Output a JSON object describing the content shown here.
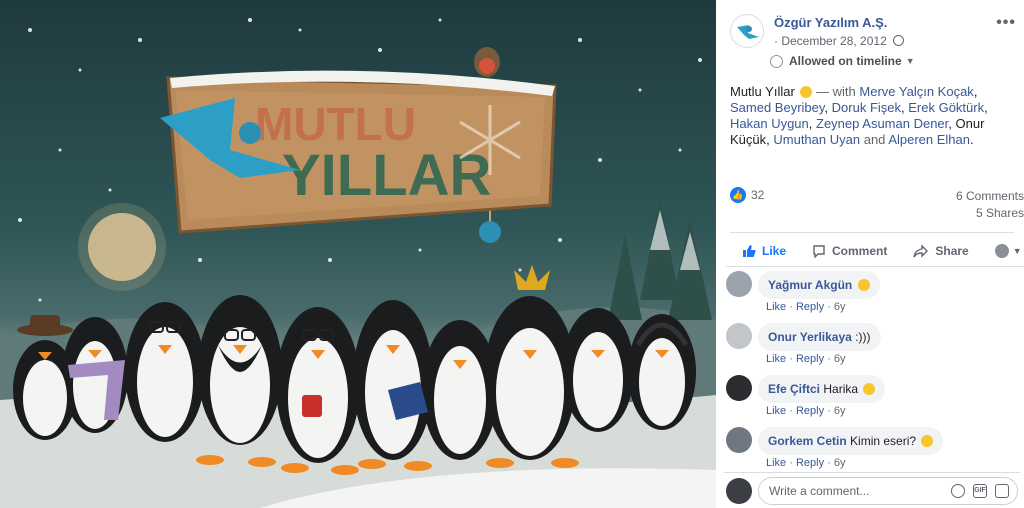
{
  "sign": {
    "line1": "MUTLU",
    "line2": "YILLAR"
  },
  "page": {
    "name": "Özgür Yazılım A.Ş.",
    "date": "December 28, 2012"
  },
  "audience": {
    "label": "Allowed on timeline"
  },
  "post": {
    "text_start": "Mutlu Yıllar",
    "with_label": "— with",
    "tagged": [
      "Merve Yalçın Koçak",
      "Samed Beyribey",
      "Doruk Fişek",
      "Erek Göktürk",
      "Hakan Uygun",
      "Zeynep Asuman Dener",
      "Onur Küçük",
      "Umuthan Uyan",
      "Alperen Elhan"
    ],
    "and_label": "and",
    "end": "."
  },
  "stats": {
    "likes": "32",
    "comments": "6 Comments",
    "shares": "5 Shares"
  },
  "actions": {
    "like": "Like",
    "comment": "Comment",
    "share": "Share"
  },
  "comments": [
    {
      "name": "Yağmur Akgün",
      "text": "",
      "like": "Like",
      "reply": "Reply",
      "time": "6y"
    },
    {
      "name": "Onur Yerlikaya",
      "text": ":)))",
      "like": "Like",
      "reply": "Reply",
      "time": "6y"
    },
    {
      "name": "Efe Çiftci",
      "text": "Harika",
      "like": "Like",
      "reply": "Reply",
      "time": "6y"
    },
    {
      "name": "Gorkem Cetin",
      "text": "Kimin eseri?",
      "like": "Like",
      "reply": "Reply",
      "time": "6y"
    }
  ],
  "composer": {
    "placeholder": "Write a comment...",
    "gif": "GIF"
  },
  "colors": {
    "link": "#385898",
    "like_blue": "#1877f2",
    "sign_wood": "#b98a5a",
    "sign_text": "#3f6b52"
  }
}
